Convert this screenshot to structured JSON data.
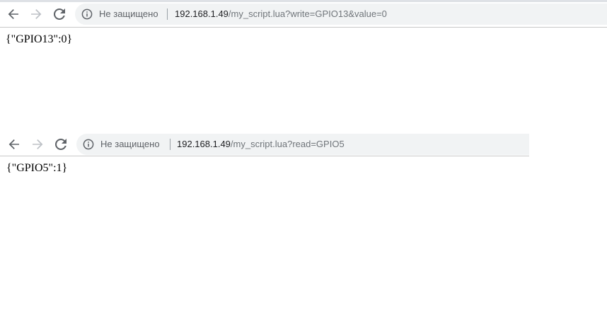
{
  "windows": [
    {
      "security_label": "Не защищено",
      "url_host": "192.168.1.49",
      "url_path": "/my_script.lua?write=GPIO13&value=0",
      "body_text": "{\"GPIO13\":0}"
    },
    {
      "security_label": "Не защищено",
      "url_host": "192.168.1.49",
      "url_path": "/my_script.lua?read=GPIO5",
      "body_text": "{\"GPIO5\":1}"
    }
  ],
  "icons": {
    "back": "arrow-left-icon",
    "forward": "arrow-right-icon",
    "reload": "reload-icon",
    "info": "info-icon"
  },
  "colors": {
    "omnibox_bg": "#f1f3f4",
    "url_host": "#202124",
    "url_path": "#70757a",
    "icon_active": "#5f6368",
    "icon_disabled": "#bdc1c6"
  }
}
